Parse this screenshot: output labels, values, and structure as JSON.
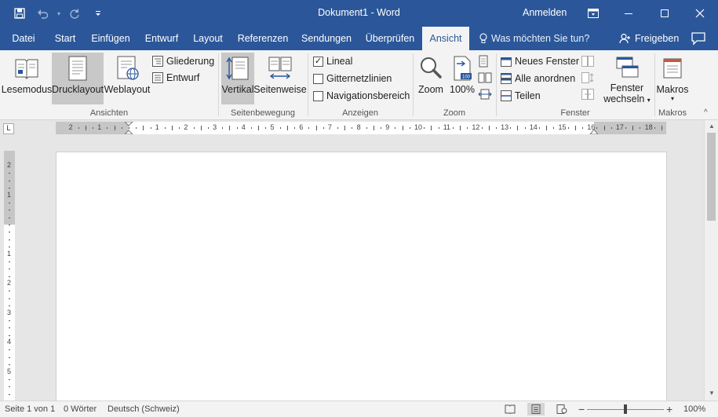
{
  "titlebar": {
    "title": "Dokument1  -  Word",
    "signin": "Anmelden",
    "icons": [
      "save-icon",
      "undo-icon",
      "redo-icon",
      "customize-qat-icon",
      "ribbon-display-icon",
      "minimize-icon",
      "maximize-icon",
      "close-icon"
    ]
  },
  "tabs": [
    "Datei",
    "Start",
    "Einfügen",
    "Entwurf",
    "Layout",
    "Referenzen",
    "Sendungen",
    "Überprüfen",
    "Ansicht"
  ],
  "active_tab": "Ansicht",
  "tellme": "Was möchten Sie tun?",
  "share": "Freigeben",
  "ribbon": {
    "views": {
      "read_mode": "Lesemodus",
      "print_layout": "Drucklayout",
      "web_layout": "Weblayout",
      "outline": "Gliederung",
      "draft": "Entwurf",
      "group": "Ansichten"
    },
    "page_movement": {
      "vertical": "Vertikal",
      "side_to_side": "Seitenweise",
      "group": "Seitenbewegung"
    },
    "show": {
      "ruler": "Lineal",
      "gridlines": "Gitternetzlinien",
      "navigation": "Navigationsbereich",
      "ruler_checked": true,
      "gridlines_checked": false,
      "navigation_checked": false,
      "group": "Anzeigen"
    },
    "zoom": {
      "zoom": "Zoom",
      "percent": "100%",
      "badge": "100",
      "group": "Zoom"
    },
    "window": {
      "new_window": "Neues Fenster",
      "arrange_all": "Alle anordnen",
      "split": "Teilen",
      "switch_line1": "Fenster",
      "switch_line2": "wechseln",
      "group": "Fenster"
    },
    "macros": {
      "label": "Makros",
      "group": "Makros"
    }
  },
  "ruler": {
    "h_ticks": [
      "2",
      "1",
      "1",
      "2",
      "3",
      "4",
      "5",
      "6",
      "7",
      "8",
      "9",
      "10",
      "11",
      "12",
      "13",
      "14",
      "15",
      "16",
      "17",
      "18"
    ],
    "v_ticks": [
      "2",
      "1",
      "1",
      "2",
      "3",
      "4",
      "5"
    ],
    "corner": "L"
  },
  "status": {
    "page": "Seite 1 von 1",
    "words": "0 Wörter",
    "language": "Deutsch (Schweiz)",
    "zoom": "100%",
    "zoom_minus": "−",
    "zoom_plus": "+"
  },
  "colors": {
    "accent": "#2b579a",
    "ribbon_bg": "#f3f3f3",
    "workspace": "#e6e6e6",
    "selected": "#c8c8c8"
  }
}
